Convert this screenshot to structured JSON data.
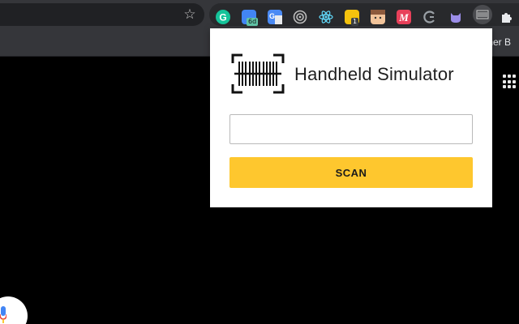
{
  "browser": {
    "bookmark_text": "ther B",
    "extensions": [
      {
        "name": "grammarly-icon",
        "glyph": "G",
        "color": "#15c39a"
      },
      {
        "name": "calendar-extension-icon",
        "badge": "6d",
        "color": "#4285f4"
      },
      {
        "name": "google-translate-icon",
        "glyph": "G",
        "color": "#4a8af4"
      },
      {
        "name": "target-extension-icon",
        "color": "#bdbdbd"
      },
      {
        "name": "react-devtools-icon",
        "color": "#61dafb"
      },
      {
        "name": "notes-extension-icon",
        "badge": "1",
        "color": "#f4c20d"
      },
      {
        "name": "face-extension-icon",
        "color": "#f2c49b"
      },
      {
        "name": "m-extension-icon",
        "glyph": "M",
        "color": "#e8405a"
      },
      {
        "name": "g-extension-icon",
        "glyph": "G",
        "color": "#9aa0a6"
      },
      {
        "name": "github-cat-icon",
        "color": "#9b8de8"
      },
      {
        "name": "handheld-simulator-extension-icon",
        "color": "#9aa0a6"
      },
      {
        "name": "puzzle-extensions-icon",
        "color": "#e8eaed"
      }
    ]
  },
  "popup": {
    "title": "Handheld Simulator",
    "input_value": "",
    "scan_label": "SCAN",
    "accent": "#fec72e"
  }
}
